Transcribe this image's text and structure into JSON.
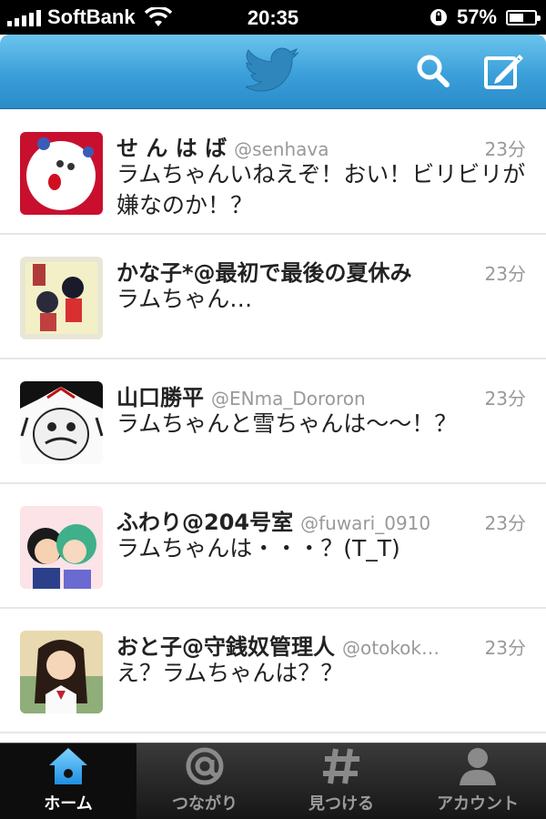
{
  "status_bar": {
    "carrier": "SoftBank",
    "time": "20:35",
    "battery": "57%",
    "battery_level": 0.57
  },
  "nav_bar": {
    "logo_icon": "twitter-bird-icon",
    "search_icon": "search-icon",
    "compose_icon": "compose-icon",
    "accent_color": "#3a9fd9"
  },
  "timeline": {
    "tweets": [
      {
        "name": "せ ん は ば",
        "handle": "@senhava",
        "time": "23分",
        "text": "ラムちゃんいねえぞ！おい！ビリビリが嫌なのか！？"
      },
      {
        "name": "かな子*@最初で最後の夏休み",
        "handle": "",
        "time": "23分",
        "text": "ラムちゃん…"
      },
      {
        "name": "山口勝平",
        "handle": "@ENma_Dororon",
        "time": "23分",
        "text": "ラムちゃんと雪ちゃんは〜〜！？"
      },
      {
        "name": "ふわり@204号室",
        "handle": "@fuwari_0910",
        "time": "23分",
        "text": "ラムちゃんは・・・？(T_T)"
      },
      {
        "name": "おと子@守銭奴管理人",
        "handle": "@otokok…",
        "time": "23分",
        "text": "え？ラムちゃんは？？"
      }
    ]
  },
  "tab_bar": {
    "tabs": [
      {
        "label": "ホーム",
        "icon": "home-icon",
        "active": true
      },
      {
        "label": "つながり",
        "icon": "at-sign-icon",
        "active": false
      },
      {
        "label": "見つける",
        "icon": "hashtag-icon",
        "active": false
      },
      {
        "label": "アカウント",
        "icon": "person-icon",
        "active": false
      }
    ]
  }
}
